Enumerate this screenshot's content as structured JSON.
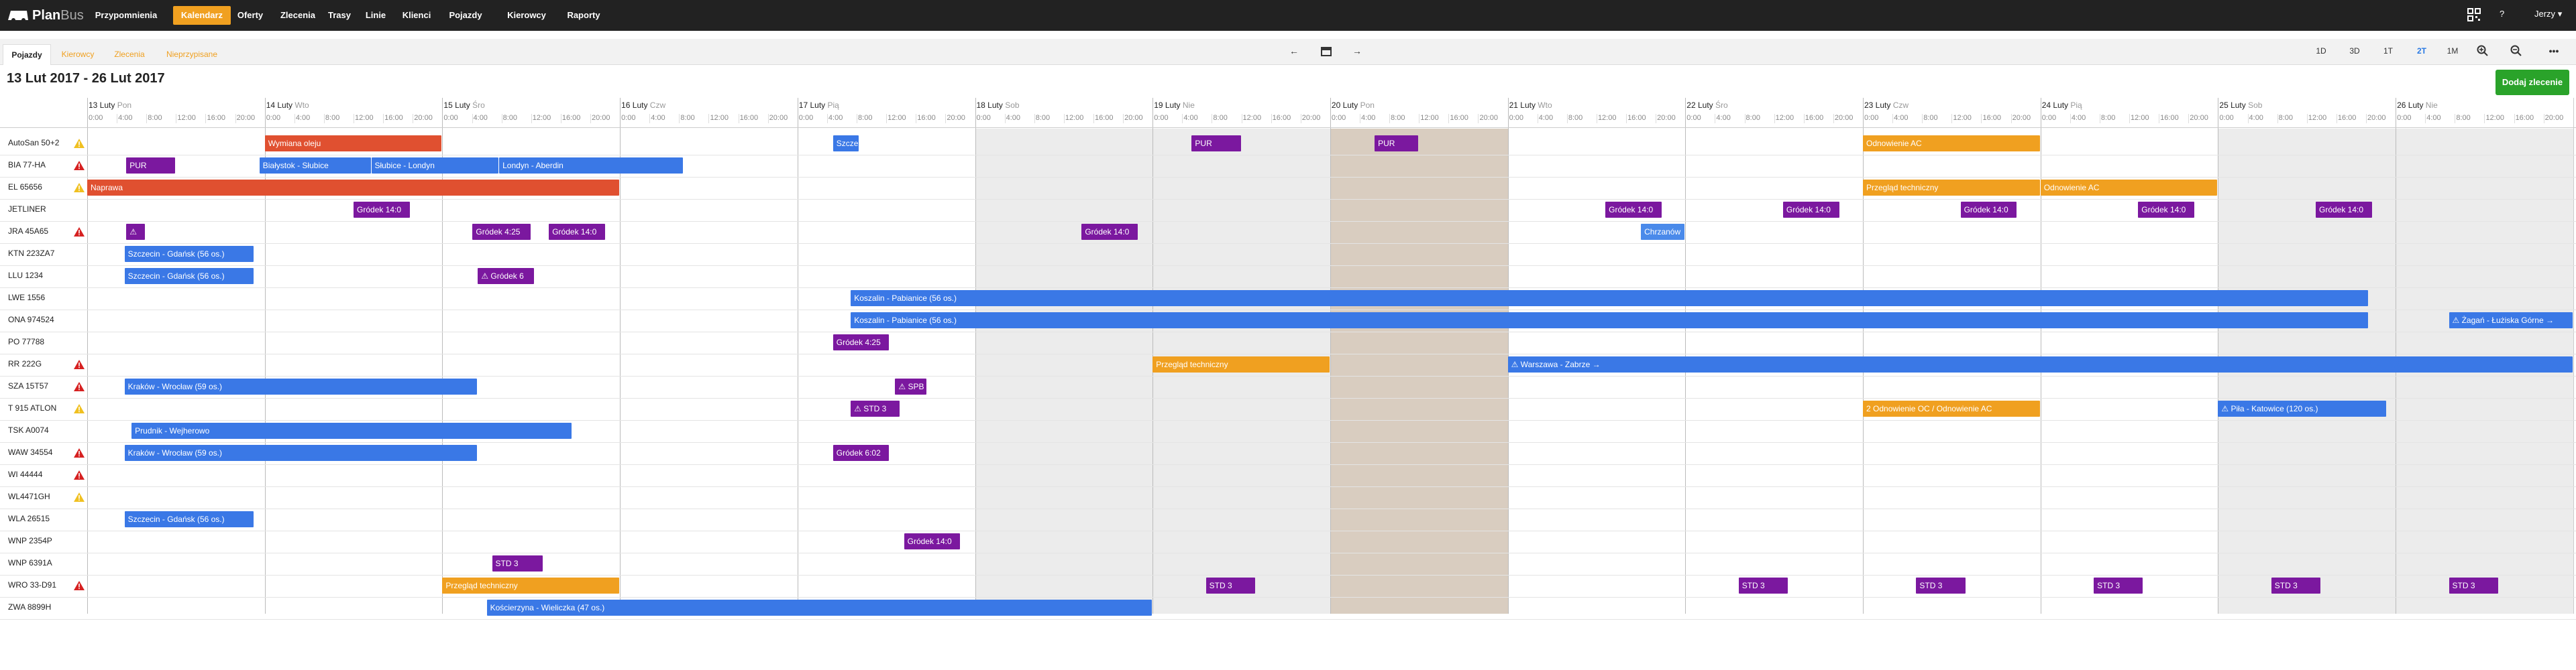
{
  "nav": {
    "logo_plan": "Plan",
    "logo_bus": "Bus",
    "items": [
      "Przypomnienia",
      "Kalendarz",
      "Oferty",
      "Zlecenia",
      "Trasy",
      "Linie",
      "Klienci",
      "Pojazdy",
      "Kierowcy",
      "Raporty"
    ],
    "active_index": 1,
    "help": "?",
    "user": "Jerzy"
  },
  "subtabs": {
    "items": [
      "Pojazdy",
      "Kierowcy",
      "Zlecenia",
      "Nieprzypisane"
    ],
    "active_index": 0
  },
  "toolbar": {
    "prev": "←",
    "calendar": "📅",
    "next": "→",
    "views": [
      "1D",
      "3D",
      "1T",
      "2T",
      "1M"
    ],
    "active_view": "2T",
    "zoom_in": "⊕",
    "zoom_out": "⊖",
    "more": "•••"
  },
  "range_title": "13 Lut 2017 - 26 Lut 2017",
  "add_button": "Dodaj zlecenie",
  "colors": {
    "purple": "#7b189f",
    "blue": "#3a78e6",
    "orange": "#f0a020",
    "red": "#e05030",
    "warn_red": "#d62020",
    "warn_yellow": "#f0c020",
    "active_nav": "#f0a020",
    "add_green": "#2aa32a"
  },
  "days": [
    {
      "date": "13 Luty",
      "day": "Pon"
    },
    {
      "date": "14 Luty",
      "day": "Wto"
    },
    {
      "date": "15 Luty",
      "day": "Śro"
    },
    {
      "date": "16 Luty",
      "day": "Czw"
    },
    {
      "date": "17 Luty",
      "day": "Pią"
    },
    {
      "date": "18 Luty",
      "day": "Sob"
    },
    {
      "date": "19 Luty",
      "day": "Nie"
    },
    {
      "date": "20 Luty",
      "day": "Pon"
    },
    {
      "date": "21 Luty",
      "day": "Wto"
    },
    {
      "date": "22 Luty",
      "day": "Śro"
    },
    {
      "date": "23 Luty",
      "day": "Czw"
    },
    {
      "date": "24 Luty",
      "day": "Pią"
    },
    {
      "date": "25 Luty",
      "day": "Sob"
    },
    {
      "date": "26 Luty",
      "day": "Nie"
    }
  ],
  "hours": [
    "0:00",
    "4:00",
    "8:00",
    "12:00",
    "16:00",
    "20:00"
  ],
  "highlight_day_index": 7,
  "weekend_day_indices": [
    5,
    6,
    12,
    13
  ],
  "vehicles": [
    {
      "name": "AutoSan 50+2",
      "warn": "yellow"
    },
    {
      "name": "BIA 77-HA",
      "warn": "red"
    },
    {
      "name": "EL 65656",
      "warn": "yellow"
    },
    {
      "name": "JETLINER",
      "warn": ""
    },
    {
      "name": "JRA 45A65",
      "warn": "red"
    },
    {
      "name": "KTN 223ZA7",
      "warn": ""
    },
    {
      "name": "LLU 1234",
      "warn": ""
    },
    {
      "name": "LWE 1556",
      "warn": ""
    },
    {
      "name": "ONA 974524",
      "warn": ""
    },
    {
      "name": "PO 77788",
      "warn": ""
    },
    {
      "name": "RR 222G",
      "warn": "red"
    },
    {
      "name": "SZA 15T57",
      "warn": "red"
    },
    {
      "name": "T 915 ATLON",
      "warn": "yellow"
    },
    {
      "name": "TSK A0074",
      "warn": ""
    },
    {
      "name": "WAW 34554",
      "warn": "red"
    },
    {
      "name": "WI 44444",
      "warn": "red"
    },
    {
      "name": "WL4471GH",
      "warn": "yellow"
    },
    {
      "name": "WLA 26515",
      "warn": ""
    },
    {
      "name": "WNP 2354P",
      "warn": ""
    },
    {
      "name": "WNP 6391A",
      "warn": ""
    },
    {
      "name": "WRO 33-D91",
      "warn": "red"
    },
    {
      "name": "ZWA 8899H",
      "warn": ""
    }
  ],
  "events": [
    {
      "row": 0,
      "start": 1.0,
      "end": 2.0,
      "label": "Wymiana oleju",
      "color": "red"
    },
    {
      "row": 0,
      "start": 4.2,
      "end": 4.35,
      "label": "Szcze",
      "color": "blue"
    },
    {
      "row": 0,
      "start": 6.22,
      "end": 6.5,
      "label": "PUR",
      "color": "purple"
    },
    {
      "row": 0,
      "start": 7.25,
      "end": 7.5,
      "label": "PUR",
      "color": "purple"
    },
    {
      "row": 0,
      "start": 10.0,
      "end": 11.0,
      "label": "Odnowienie AC",
      "color": "orange"
    },
    {
      "row": 1,
      "start": 0.22,
      "end": 0.5,
      "label": "PUR",
      "color": "purple"
    },
    {
      "row": 1,
      "start": 0.97,
      "end": 1.6,
      "label": "Białystok - Słubice",
      "color": "blue"
    },
    {
      "row": 1,
      "start": 1.6,
      "end": 2.32,
      "label": "Słubice - Londyn",
      "color": "blue"
    },
    {
      "row": 1,
      "start": 2.32,
      "end": 3.36,
      "label": "Londyn - Aberdin",
      "color": "blue"
    },
    {
      "row": 2,
      "start": 0.0,
      "end": 3.0,
      "label": "Naprawa",
      "color": "red"
    },
    {
      "row": 2,
      "start": 10.0,
      "end": 11.0,
      "label": "Przegląd techniczny",
      "color": "orange"
    },
    {
      "row": 2,
      "start": 11.0,
      "end": 12.0,
      "label": "Odnowienie AC",
      "color": "orange"
    },
    {
      "row": 3,
      "start": 1.5,
      "end": 1.82,
      "label": "Gródek 14:0",
      "color": "purple"
    },
    {
      "row": 3,
      "start": 8.55,
      "end": 8.87,
      "label": "Gródek 14:0",
      "color": "purple"
    },
    {
      "row": 3,
      "start": 9.55,
      "end": 9.87,
      "label": "Gródek 14:0",
      "color": "purple"
    },
    {
      "row": 3,
      "start": 10.55,
      "end": 10.87,
      "label": "Gródek 14:0",
      "color": "purple"
    },
    {
      "row": 3,
      "start": 11.55,
      "end": 11.87,
      "label": "Gródek 14:0",
      "color": "purple"
    },
    {
      "row": 3,
      "start": 12.55,
      "end": 12.87,
      "label": "Gródek 14:0",
      "color": "purple"
    },
    {
      "row": 4,
      "start": 0.22,
      "end": 0.33,
      "label": "⚠",
      "color": "purple"
    },
    {
      "row": 4,
      "start": 2.17,
      "end": 2.5,
      "label": "Gródek 4:25",
      "color": "purple"
    },
    {
      "row": 4,
      "start": 2.6,
      "end": 2.92,
      "label": "Gródek 14:0",
      "color": "purple"
    },
    {
      "row": 4,
      "start": 5.6,
      "end": 5.92,
      "label": "Gródek 14:0",
      "color": "purple"
    },
    {
      "row": 4,
      "start": 8.75,
      "end": 9.0,
      "label": "Chrzanów",
      "color": "lblue"
    },
    {
      "row": 5,
      "start": 0.21,
      "end": 0.94,
      "label": "Szczecin - Gdańsk (56 os.)",
      "color": "blue"
    },
    {
      "row": 6,
      "start": 0.21,
      "end": 0.94,
      "label": "Szczecin - Gdańsk (56 os.)",
      "color": "blue"
    },
    {
      "row": 6,
      "start": 2.2,
      "end": 2.52,
      "label": "⚠ Gródek 6",
      "color": "purple"
    },
    {
      "row": 7,
      "start": 4.3,
      "end": 12.85,
      "label": "Koszalin - Pabianice (56 os.)",
      "color": "blue"
    },
    {
      "row": 8,
      "start": 4.3,
      "end": 12.85,
      "label": "Koszalin - Pabianice (56 os.)",
      "color": "blue"
    },
    {
      "row": 8,
      "start": 13.3,
      "end": 14.0,
      "label": "⚠ Żagań - Łużiska Górne →",
      "color": "blue"
    },
    {
      "row": 9,
      "start": 4.2,
      "end": 4.52,
      "label": "Gródek 4:25",
      "color": "purple"
    },
    {
      "row": 10,
      "start": 6.0,
      "end": 7.0,
      "label": "Przegląd techniczny",
      "color": "orange"
    },
    {
      "row": 10,
      "start": 8.0,
      "end": 14.0,
      "label": "⚠ Warszawa - Zabrze →",
      "color": "blue"
    },
    {
      "row": 11,
      "start": 0.21,
      "end": 2.2,
      "label": "Kraków - Wrocław (59 os.)",
      "color": "blue"
    },
    {
      "row": 11,
      "start": 4.55,
      "end": 4.73,
      "label": "⚠ SPB",
      "color": "purple"
    },
    {
      "row": 12,
      "start": 4.3,
      "end": 4.58,
      "label": "⚠ STD 3",
      "color": "purple"
    },
    {
      "row": 12,
      "start": 10.0,
      "end": 11.0,
      "label": "2 Odnowienie OC / Odnowienie AC",
      "color": "orange"
    },
    {
      "row": 12,
      "start": 12.0,
      "end": 12.95,
      "label": "⚠ Piła - Katowice (120 os.)",
      "color": "blue"
    },
    {
      "row": 13,
      "start": 0.25,
      "end": 2.73,
      "label": "Prudnik - Wejherowo",
      "color": "blue"
    },
    {
      "row": 14,
      "start": 0.21,
      "end": 2.2,
      "label": "Kraków - Wrocław (59 os.)",
      "color": "blue"
    },
    {
      "row": 14,
      "start": 4.2,
      "end": 4.52,
      "label": "Gródek 6:02",
      "color": "purple"
    },
    {
      "row": 17,
      "start": 0.21,
      "end": 0.94,
      "label": "Szczecin - Gdańsk (56 os.)",
      "color": "blue"
    },
    {
      "row": 18,
      "start": 4.6,
      "end": 4.92,
      "label": "Gródek 14:0",
      "color": "purple"
    },
    {
      "row": 19,
      "start": 2.28,
      "end": 2.57,
      "label": "STD 3",
      "color": "purple"
    },
    {
      "row": 20,
      "start": 2.0,
      "end": 3.0,
      "label": "Przegląd techniczny",
      "color": "orange"
    },
    {
      "row": 20,
      "start": 6.3,
      "end": 6.58,
      "label": "STD 3",
      "color": "purple"
    },
    {
      "row": 20,
      "start": 9.3,
      "end": 9.58,
      "label": "STD 3",
      "color": "purple"
    },
    {
      "row": 20,
      "start": 10.3,
      "end": 10.58,
      "label": "STD 3",
      "color": "purple"
    },
    {
      "row": 20,
      "start": 11.3,
      "end": 11.58,
      "label": "STD 3",
      "color": "purple"
    },
    {
      "row": 20,
      "start": 12.3,
      "end": 12.58,
      "label": "STD 3",
      "color": "purple"
    },
    {
      "row": 20,
      "start": 13.3,
      "end": 13.58,
      "label": "STD 3",
      "color": "purple"
    },
    {
      "row": 21,
      "start": 2.25,
      "end": 6.0,
      "label": "Kościerzyna - Wieliczka (47 os.)",
      "color": "blue"
    }
  ]
}
